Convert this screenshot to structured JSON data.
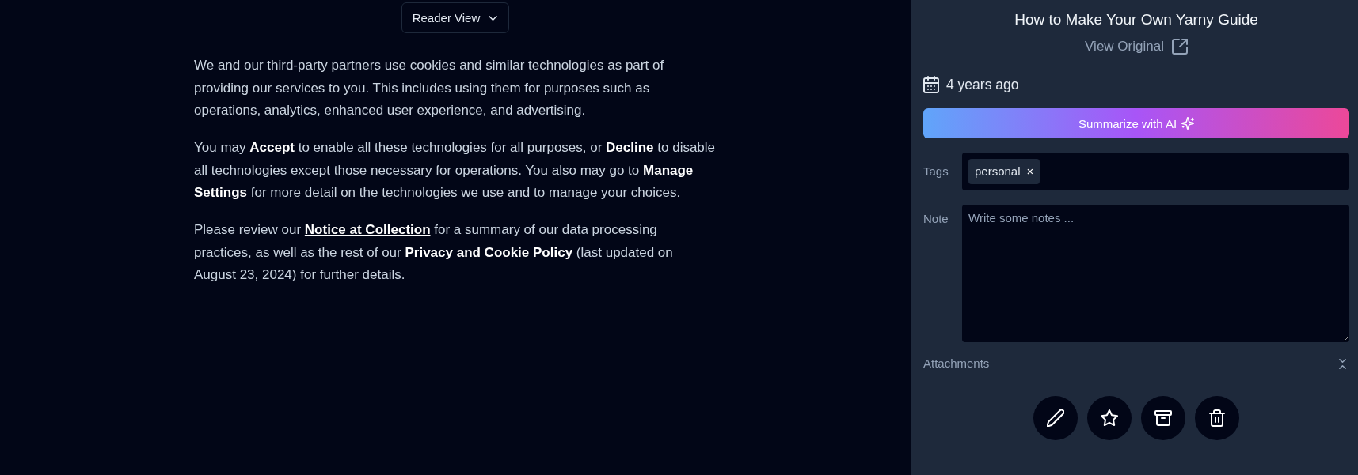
{
  "reader_view": {
    "label": "Reader View"
  },
  "article": {
    "paragraphs": [
      [
        {
          "kind": "text",
          "text": "We and our third-party partners use cookies and similar technologies as part of providing our services to you. This includes using them for purposes such as operations, analytics, enhanced user experience, and advertising."
        }
      ],
      [
        {
          "kind": "text",
          "text": "You may **Accept** to enable all these technologies for all purposes, or **Decline** to disable all technologies except those necessary for operations. You also may go to **Manage Settings** for more detail on the technologies we use and to manage your choices."
        }
      ],
      [
        {
          "kind": "text",
          "text": "Please review our "
        },
        {
          "kind": "link",
          "text": "Notice at Collection"
        },
        {
          "kind": "text",
          "text": " for a summary of our data processing practices, as well as the rest of our "
        },
        {
          "kind": "link",
          "text": "Privacy and Cookie Policy"
        },
        {
          "kind": "text",
          "text": " (last updated on August 23, 2024) for further details."
        }
      ]
    ]
  },
  "details": {
    "title": "How to Make Your Own Yarny Guide",
    "view_original": "View Original",
    "date": "4 years ago",
    "summarize_button": "Summarize with AI",
    "tags_label": "Tags",
    "tags": [
      {
        "label": "personal",
        "remove": "×"
      }
    ],
    "note_label": "Note",
    "note": {
      "placeholder": "Write some notes ..."
    },
    "attachments_label": "Attachments",
    "actions": [
      {
        "kind": "edit"
      },
      {
        "kind": "favourite"
      },
      {
        "kind": "archive"
      },
      {
        "kind": "delete"
      }
    ]
  }
}
